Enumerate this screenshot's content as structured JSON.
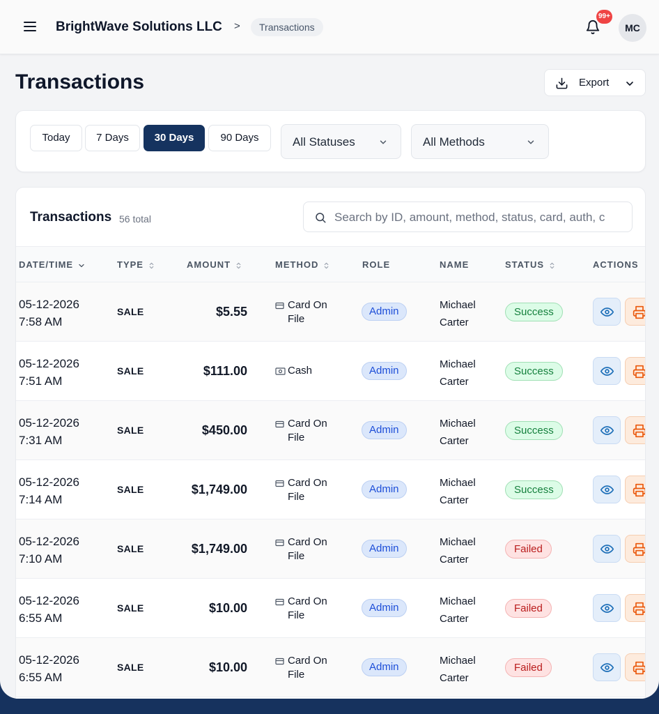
{
  "header": {
    "company": "BrightWave Solutions LLC",
    "breadcrumb_separator": ">",
    "breadcrumb_current": "Transactions",
    "notification_badge": "99+",
    "avatar_initials": "MC"
  },
  "page": {
    "title": "Transactions",
    "export_label": "Export"
  },
  "filters": {
    "ranges": [
      "Today",
      "7 Days",
      "30 Days",
      "90 Days"
    ],
    "active_range": "30 Days",
    "status_select": "All Statuses",
    "method_select": "All Methods"
  },
  "table": {
    "title": "Transactions",
    "count": "56 total",
    "search_placeholder": "Search by ID, amount, method, status, card, auth, c",
    "columns": [
      "DATE/TIME",
      "TYPE",
      "AMOUNT",
      "METHOD",
      "ROLE",
      "NAME",
      "STATUS",
      "ACTIONS"
    ],
    "rows": [
      {
        "date": "05-12-2026",
        "time": "7:58 AM",
        "type": "SALE",
        "amount": "$5.55",
        "method_line1": "Card On",
        "method_line2": "File",
        "method_icon": "card-icon",
        "role": "Admin",
        "name_line1": "Michael",
        "name_line2": "Carter",
        "status": "Success"
      },
      {
        "date": "05-12-2026",
        "time": "7:51 AM",
        "type": "SALE",
        "amount": "$111.00",
        "method_line1": "Cash",
        "method_line2": "",
        "method_icon": "cash-icon",
        "role": "Admin",
        "name_line1": "Michael",
        "name_line2": "Carter",
        "status": "Success"
      },
      {
        "date": "05-12-2026",
        "time": "7:31 AM",
        "type": "SALE",
        "amount": "$450.00",
        "method_line1": "Card On",
        "method_line2": "File",
        "method_icon": "card-icon",
        "role": "Admin",
        "name_line1": "Michael",
        "name_line2": "Carter",
        "status": "Success"
      },
      {
        "date": "05-12-2026",
        "time": "7:14 AM",
        "type": "SALE",
        "amount": "$1,749.00",
        "method_line1": "Card On",
        "method_line2": "File",
        "method_icon": "card-icon",
        "role": "Admin",
        "name_line1": "Michael",
        "name_line2": "Carter",
        "status": "Success"
      },
      {
        "date": "05-12-2026",
        "time": "7:10 AM",
        "type": "SALE",
        "amount": "$1,749.00",
        "method_line1": "Card On",
        "method_line2": "File",
        "method_icon": "card-icon",
        "role": "Admin",
        "name_line1": "Michael",
        "name_line2": "Carter",
        "status": "Failed"
      },
      {
        "date": "05-12-2026",
        "time": "6:55 AM",
        "type": "SALE",
        "amount": "$10.00",
        "method_line1": "Card On",
        "method_line2": "File",
        "method_icon": "card-icon",
        "role": "Admin",
        "name_line1": "Michael",
        "name_line2": "Carter",
        "status": "Failed"
      },
      {
        "date": "05-12-2026",
        "time": "6:55 AM",
        "type": "SALE",
        "amount": "$10.00",
        "method_line1": "Card On",
        "method_line2": "File",
        "method_icon": "card-icon",
        "role": "Admin",
        "name_line1": "Michael",
        "name_line2": "Carter",
        "status": "Failed"
      }
    ]
  },
  "colors": {
    "brand_navy": "#15335f",
    "success": "#15803d",
    "failed": "#b91c1c",
    "role_blue": "#1d4ed8"
  }
}
